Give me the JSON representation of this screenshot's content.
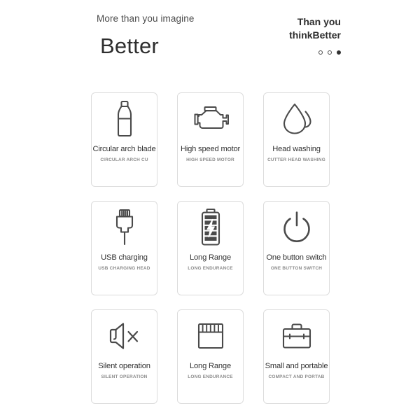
{
  "header": {
    "tagline": "More than you imagine",
    "headline": "Better",
    "sub_line_1": "Than you",
    "sub_line_2": "thinkBetter",
    "pagination": {
      "total": 3,
      "active_index": 2,
      "dots": [
        "dot-1",
        "dot-2",
        "dot-3"
      ]
    }
  },
  "colors": {
    "background": "#ffffff",
    "card_background": "#ffffff",
    "card_border": "#dcdcdc",
    "title_text": "#333333",
    "sub_text": "#8a8a8a",
    "icon_stroke": "#4a4a4a",
    "dot_active": "#333333"
  },
  "cards": [
    {
      "icon": "bottle-blade-icon",
      "title": "Circular arch blade",
      "subtitle": "CIRCULAR ARCH CU"
    },
    {
      "icon": "motor-icon",
      "title": "High speed motor",
      "subtitle": "HIGH SPEED MOTOR"
    },
    {
      "icon": "water-drop-icon",
      "title": "Head washing",
      "subtitle": "CUTTER HEAD WASHING"
    },
    {
      "icon": "usb-plug-icon",
      "title": "USB charging",
      "subtitle": "USB CHARGING HEAD"
    },
    {
      "icon": "battery-charging-icon",
      "title": "Long Range",
      "subtitle": "LONG ENDURANCE"
    },
    {
      "icon": "power-button-icon",
      "title": "One button switch",
      "subtitle": "ONE BUTTON SWITCH"
    },
    {
      "icon": "mute-speaker-icon",
      "title": "Silent operation",
      "subtitle": "SILENT OPERATION"
    },
    {
      "icon": "battery-bars-icon",
      "title": "Long Range",
      "subtitle": "LONG ENDURANCE"
    },
    {
      "icon": "briefcase-icon",
      "title": "Small and portable",
      "subtitle": "COMPACT AND PORTAB"
    }
  ]
}
